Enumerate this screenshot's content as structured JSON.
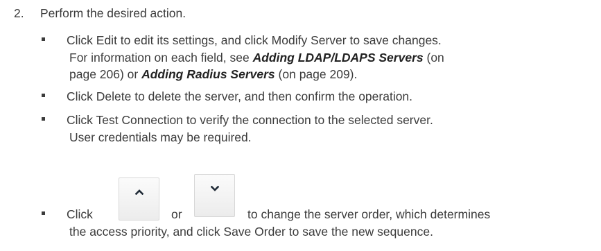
{
  "step": {
    "number": "2.",
    "text": "Perform the desired action."
  },
  "bullets": [
    {
      "lines": [
        {
          "parts": [
            "Click Edit to edit its settings, and click Modify Server to save changes."
          ]
        },
        {
          "parts": [
            "For information on each field, see ",
            "Adding LDAP/LDAPS Servers",
            " (on"
          ]
        },
        {
          "parts": [
            "page 206) or ",
            "Adding Radius Servers",
            " (on page 209)."
          ]
        }
      ]
    },
    {
      "lines": [
        {
          "parts": [
            "Click Delete to delete the server, and then confirm the operation."
          ]
        }
      ]
    },
    {
      "lines": [
        {
          "parts": [
            "Click Test Connection to verify the connection to the selected server."
          ]
        },
        {
          "parts": [
            "User credentials may be required."
          ]
        }
      ]
    },
    {
      "click": "Click",
      "or": "or",
      "rest1": "to change the server order, which determines",
      "rest2": "the access priority, and click Save Order to save the new sequence.",
      "icons": [
        "move-up-arrow-icon",
        "move-down-arrow-icon"
      ]
    }
  ]
}
